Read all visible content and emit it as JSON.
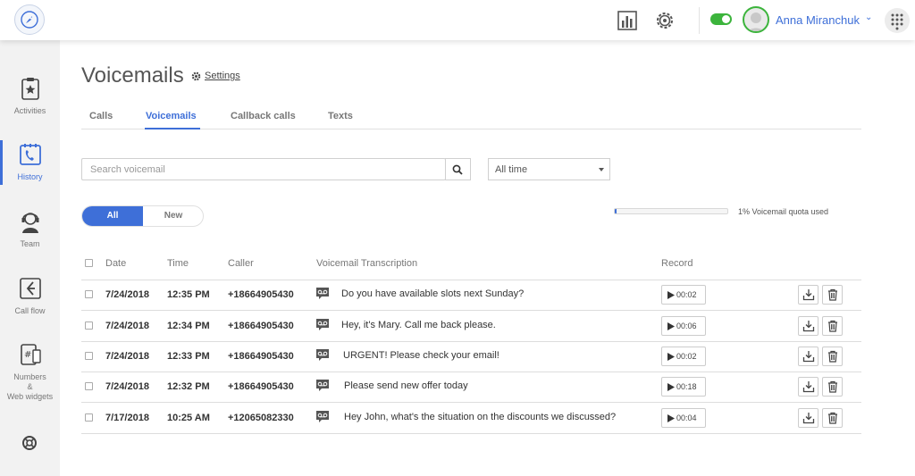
{
  "header": {
    "user_name": "Anna Miranchuk",
    "status_on": true,
    "accent_color": "#3e6fd8",
    "status_color": "#3cb43c"
  },
  "sidebar": {
    "items": [
      {
        "label": "Activities",
        "icon": "clipboard-star-icon",
        "active": false
      },
      {
        "label": "History",
        "icon": "phone-calendar-icon",
        "active": true
      },
      {
        "label": "Team",
        "icon": "headset-agent-icon",
        "active": false
      },
      {
        "label": "Call flow",
        "icon": "call-flow-icon",
        "active": false
      },
      {
        "label": "Numbers",
        "label2": "&",
        "label3": "Web widgets",
        "icon": "number-devices-icon",
        "active": false
      }
    ],
    "help_icon": "lifebuoy-icon"
  },
  "page": {
    "title": "Voicemails",
    "settings_label": "Settings"
  },
  "tabs": [
    {
      "label": "Calls",
      "active": false
    },
    {
      "label": "Voicemails",
      "active": true
    },
    {
      "label": "Callback calls",
      "active": false
    },
    {
      "label": "Texts",
      "active": false
    }
  ],
  "search": {
    "placeholder": "Search voicemail",
    "value": ""
  },
  "time_filter": {
    "selected": "All time"
  },
  "segment": {
    "all_label": "All",
    "new_label": "New",
    "selected": "All"
  },
  "quota": {
    "percent_used": 1,
    "label": "1% Voicemail quota used"
  },
  "table": {
    "headers": {
      "date": "Date",
      "time": "Time",
      "caller": "Caller",
      "transcription": "Voicemail Transcription",
      "record": "Record"
    },
    "rows": [
      {
        "date": "7/24/2018",
        "time": "12:35 PM",
        "caller": "+18664905430",
        "transcription": "Do you have available slots next Sunday?",
        "duration": "00:02"
      },
      {
        "date": "7/24/2018",
        "time": "12:34 PM",
        "caller": "+18664905430",
        "transcription": "Hey, it's Mary. Call me back please.",
        "duration": "00:06"
      },
      {
        "date": "7/24/2018",
        "time": "12:33 PM",
        "caller": "+18664905430",
        "transcription": "URGENT! Please check your email!",
        "duration": "00:02"
      },
      {
        "date": "7/24/2018",
        "time": "12:32 PM",
        "caller": "+18664905430",
        "transcription": "Please send new offer today",
        "duration": "00:18"
      },
      {
        "date": "7/17/2018",
        "time": "10:25 AM",
        "caller": "+12065082330",
        "transcription": "Hey John, what's the situation on the discounts we discussed?",
        "duration": "00:04"
      }
    ]
  }
}
